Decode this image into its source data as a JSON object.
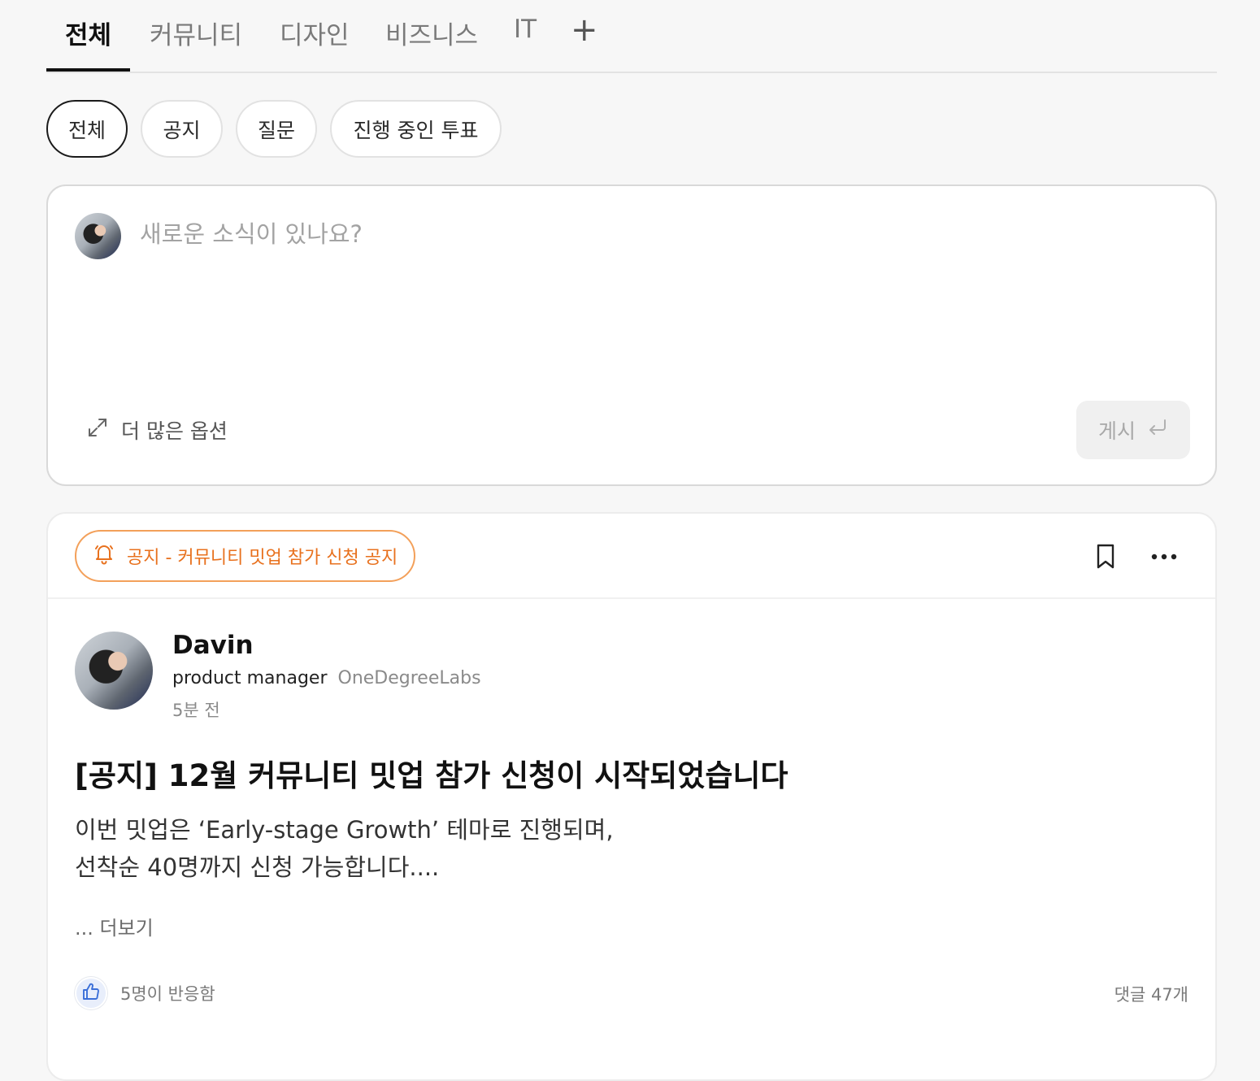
{
  "tabs": [
    {
      "label": "전체",
      "active": true
    },
    {
      "label": "커뮤니티"
    },
    {
      "label": "디자인"
    },
    {
      "label": "비즈니스"
    },
    {
      "label": "IT"
    }
  ],
  "tab_add_label": "+",
  "filters": [
    {
      "label": "전체",
      "active": true
    },
    {
      "label": "공지"
    },
    {
      "label": "질문"
    },
    {
      "label": "진행 중인 투표"
    }
  ],
  "composer": {
    "placeholder": "새로운 소식이 있나요?",
    "more_options_label": "더 많은 옵션",
    "post_label": "게시"
  },
  "post": {
    "notice_label": "공지 - 커뮤니티 밋업 참가 신청 공지",
    "author": {
      "name": "Davin",
      "role": "product manager",
      "org": "OneDegreeLabs",
      "time": "5분 전"
    },
    "title": "[공지] 12월 커뮤니티 밋업 참가 신청이 시작되었습니다",
    "body_line1": "이번 밋업은 ‘Early-stage Growth’ 테마로 진행되며,",
    "body_line2": "선착순 40명까지 신청 가능합니다....",
    "read_more": "... 더보기",
    "reactions": "5명이 반응함",
    "comments": "댓글 47개"
  },
  "colors": {
    "accent_notice": "#e8711e",
    "like_blue": "#3b6fd8"
  }
}
